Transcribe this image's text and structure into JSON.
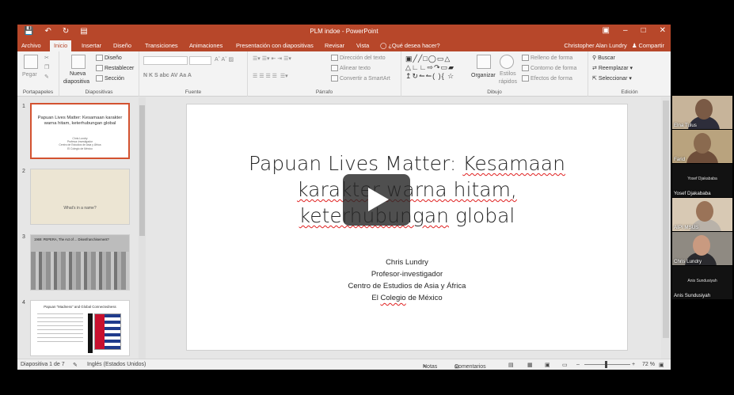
{
  "window": {
    "title": "PLM indoe - PowerPoint",
    "user": "Christopher Alan Lundry",
    "share": "Compartir",
    "tell_me": "¿Qué desea hacer?"
  },
  "tabs": [
    "Archivo",
    "Inicio",
    "Insertar",
    "Diseño",
    "Transiciones",
    "Animaciones",
    "Presentación con diapositivas",
    "Revisar",
    "Vista"
  ],
  "ribbon": {
    "portapapeles": {
      "label": "Portapapeles",
      "pegar": "Pegar"
    },
    "diapositivas": {
      "label": "Diapositivas",
      "nueva": "Nueva",
      "diapositiva": "diapositiva",
      "diseno": "Diseño",
      "restablecer": "Restablecer",
      "seccion": "Sección"
    },
    "fuente": {
      "label": "Fuente",
      "buttons": "N  K  S  abc  AV   Aa    A"
    },
    "parrafo": {
      "label": "Párrafo",
      "direccion": "Dirección del texto",
      "alinear": "Alinear texto",
      "convertir": "Convertir a SmartArt"
    },
    "dibujo": {
      "label": "Dibujo",
      "organizar": "Organizar",
      "estilos": "Estilos",
      "rapidos": "rápidos",
      "relleno": "Relleno de forma",
      "contorno": "Contorno de forma",
      "efectos": "Efectos de forma"
    },
    "edicion": {
      "label": "Edición",
      "buscar": "Buscar",
      "reemplazar": "Reemplazar",
      "seleccionar": "Seleccionar"
    }
  },
  "thumbnails": [
    {
      "num": "1",
      "title": "Papuan Lives Matter: Kesamaan karakter warna hitam, keterhubungan global",
      "sub": "Chris Lundry\nProfesor-investigador\nCentro de Estudios de Asia y África\nEl Colegio de México"
    },
    {
      "num": "2",
      "text": "What's in a name?"
    },
    {
      "num": "3",
      "text": "1969: PEPERA, The Act of ... Disenfranchisement?"
    },
    {
      "num": "4",
      "text": "Papuan \"Madness\" and Global Connectedness"
    }
  ],
  "slide": {
    "title_part1": "Papuan Lives Matter: ",
    "title_part2": "Kesamaan",
    "title_part3": "karakter warna hitam,",
    "title_part4": "keterhubungan",
    "title_part5": " global",
    "author": "Chris Lundry",
    "role": "Profesor-investigador",
    "center": "Centro de Estudios de Asia y África",
    "inst1": "El ",
    "inst2": "Colegio",
    "inst3": " de México"
  },
  "status": {
    "slide_counter": "Diapositiva 1 de 7",
    "language": "Inglés (Estados Unidos)",
    "notes": "Notas",
    "comments": "Comentarios",
    "zoom": "72 %"
  },
  "participants": [
    {
      "name": "Elna Tulus"
    },
    {
      "name": "Farid"
    },
    {
      "name": "Yosef Djakababa",
      "label": "Yosef Djakababa"
    },
    {
      "name": "AIPI MSUS"
    },
    {
      "name": "Chris Lundry"
    },
    {
      "name": "Anis Sundusiyah",
      "label": "Anis Sundusiyah"
    }
  ],
  "colors": {
    "accent": "#b7472a",
    "selected_thumb": "#d35230"
  }
}
